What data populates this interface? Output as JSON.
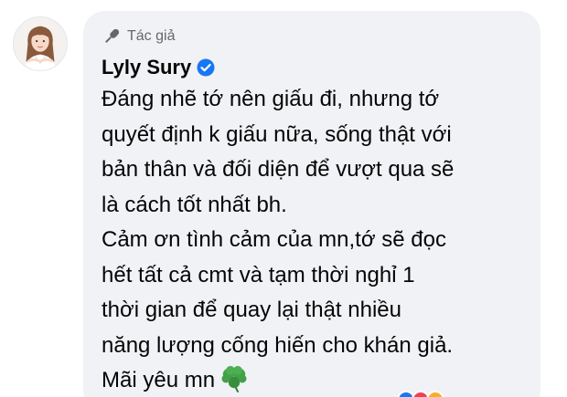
{
  "comment": {
    "author_badge": {
      "label": "Tác giả",
      "icon": "microphone-icon"
    },
    "author": {
      "name": "Lyly Sury",
      "verified_icon": "verified-check-icon",
      "verified_color": "#1877f2"
    },
    "avatar_icon": "profile-photo",
    "lines": [
      "Đáng nhẽ tớ nên giấu đi, nhưng tớ",
      "quyết định k giấu nữa, sống thật với",
      "bản thân và đối diện để vượt qua sẽ",
      "là cách tốt nhất bh.",
      "Cảm ơn tình cảm của mn,tớ sẽ đọc",
      "hết tất cả cmt và tạm thời nghỉ 1",
      "thời gian để quay lại thật nhiều",
      "năng lượng cống hiến cho khán giả.",
      "Mãi yêu mn"
    ],
    "emoji_icon": "shamrock-icon",
    "reactions": [
      {
        "icon": "like-reaction-icon",
        "color": "#1877f2"
      },
      {
        "icon": "love-reaction-icon",
        "color": "#f33e58"
      },
      {
        "icon": "care-reaction-icon",
        "color": "#f7b125"
      }
    ]
  },
  "colors": {
    "bubble_bg": "#f0f2f5",
    "text_primary": "#050505",
    "text_secondary": "#65676b"
  }
}
